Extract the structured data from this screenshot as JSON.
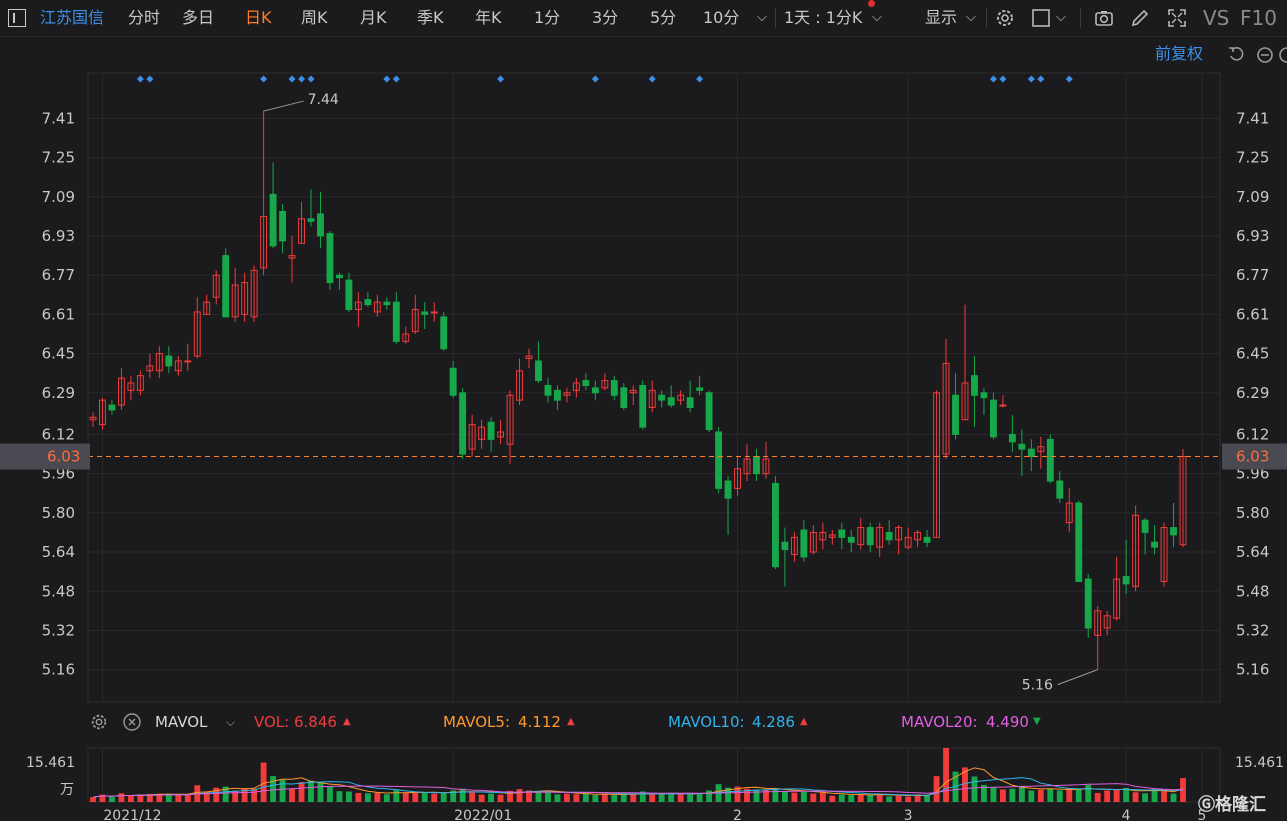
{
  "toolbar": {
    "stock_name": "江苏国信",
    "tabs": [
      "分时",
      "多日",
      "日K",
      "周K",
      "月K",
      "季K",
      "年K",
      "1分",
      "3分",
      "5分",
      "10分"
    ],
    "active_tab": "日K",
    "period_select": "1天 : 1分K",
    "display_label": "显示",
    "vs_label": "VS",
    "f10_label": "F10",
    "icons": [
      "settings-icon",
      "square-icon",
      "camera-icon",
      "pencil-icon",
      "fullscreen-icon"
    ]
  },
  "adjust_label": "前复权",
  "colors": {
    "up": "#f23b3b",
    "down": "#16a84a",
    "bg": "#1b1b1d",
    "grid": "#2a2a2c",
    "accent": "#ff7f27",
    "blue": "#3d8fe8"
  },
  "price_axis": {
    "ticks": [
      "7.41",
      "7.25",
      "7.09",
      "6.93",
      "6.77",
      "6.61",
      "6.45",
      "6.29",
      "6.12",
      "5.96",
      "5.80",
      "5.64",
      "5.48",
      "5.32",
      "5.16"
    ],
    "current": "6.03",
    "high_label": "7.44",
    "low_label": "5.16"
  },
  "mavol": {
    "title": "MAVOL",
    "vol_label": "VOL:",
    "vol_value": "6.846",
    "ma5_label": "MAVOL5:",
    "ma5_value": "4.112",
    "ma10_label": "MAVOL10:",
    "ma10_value": "4.286",
    "ma20_label": "MAVOL20:",
    "ma20_value": "4.490",
    "axis_value": "15.461",
    "axis_unit": "万"
  },
  "x_axis_labels": [
    "2021/12",
    "2022/01",
    "2",
    "3",
    "4",
    "5"
  ],
  "chart_data": {
    "type": "candlestick",
    "candles": [
      [
        6.18,
        6.19,
        6.21,
        6.15
      ],
      [
        6.16,
        6.26,
        6.27,
        6.14
      ],
      [
        6.24,
        6.22,
        6.26,
        6.2
      ],
      [
        6.24,
        6.35,
        6.39,
        6.22
      ],
      [
        6.3,
        6.33,
        6.36,
        6.26
      ],
      [
        6.3,
        6.36,
        6.38,
        6.28
      ],
      [
        6.38,
        6.4,
        6.45,
        6.35
      ],
      [
        6.38,
        6.45,
        6.48,
        6.35
      ],
      [
        6.44,
        6.4,
        6.48,
        6.37
      ],
      [
        6.38,
        6.42,
        6.44,
        6.36
      ],
      [
        6.42,
        6.42,
        6.49,
        6.38
      ],
      [
        6.44,
        6.62,
        6.68,
        6.43
      ],
      [
        6.61,
        6.66,
        6.69,
        6.61
      ],
      [
        6.68,
        6.77,
        6.79,
        6.65
      ],
      [
        6.85,
        6.6,
        6.88,
        6.6
      ],
      [
        6.6,
        6.73,
        6.8,
        6.58
      ],
      [
        6.61,
        6.74,
        6.78,
        6.58
      ],
      [
        6.6,
        6.79,
        6.81,
        6.58
      ],
      [
        6.8,
        7.01,
        7.44,
        6.77
      ],
      [
        7.1,
        6.89,
        7.23,
        6.88
      ],
      [
        7.03,
        6.91,
        7.06,
        6.86
      ],
      [
        6.84,
        6.85,
        6.93,
        6.74
      ],
      [
        6.9,
        7.0,
        7.07,
        6.9
      ],
      [
        7.0,
        6.99,
        7.12,
        6.97
      ],
      [
        7.02,
        6.93,
        7.11,
        6.88
      ],
      [
        6.94,
        6.74,
        6.95,
        6.71
      ],
      [
        6.77,
        6.76,
        6.78,
        6.71
      ],
      [
        6.75,
        6.63,
        6.78,
        6.62
      ],
      [
        6.63,
        6.66,
        6.7,
        6.56
      ],
      [
        6.67,
        6.65,
        6.7,
        6.64
      ],
      [
        6.62,
        6.66,
        6.69,
        6.6
      ],
      [
        6.66,
        6.65,
        6.68,
        6.63
      ],
      [
        6.66,
        6.5,
        6.7,
        6.49
      ],
      [
        6.5,
        6.53,
        6.56,
        6.49
      ],
      [
        6.54,
        6.63,
        6.69,
        6.53
      ],
      [
        6.62,
        6.61,
        6.66,
        6.55
      ],
      [
        6.62,
        6.62,
        6.66,
        6.58
      ],
      [
        6.6,
        6.47,
        6.62,
        6.46
      ],
      [
        6.39,
        6.28,
        6.42,
        6.27
      ],
      [
        6.29,
        6.04,
        6.31,
        6.02
      ],
      [
        6.06,
        6.16,
        6.2,
        6.03
      ],
      [
        6.1,
        6.15,
        6.18,
        6.06
      ],
      [
        6.17,
        6.1,
        6.19,
        6.05
      ],
      [
        6.11,
        6.13,
        6.18,
        6.08
      ],
      [
        6.08,
        6.28,
        6.3,
        6.0
      ],
      [
        6.26,
        6.38,
        6.43,
        6.24
      ],
      [
        6.43,
        6.44,
        6.47,
        6.39
      ],
      [
        6.42,
        6.34,
        6.5,
        6.33
      ],
      [
        6.32,
        6.28,
        6.35,
        6.25
      ],
      [
        6.3,
        6.26,
        6.32,
        6.22
      ],
      [
        6.28,
        6.29,
        6.31,
        6.25
      ],
      [
        6.3,
        6.33,
        6.35,
        6.27
      ],
      [
        6.34,
        6.32,
        6.37,
        6.3
      ],
      [
        6.31,
        6.29,
        6.34,
        6.26
      ],
      [
        6.31,
        6.34,
        6.37,
        6.3
      ],
      [
        6.34,
        6.28,
        6.36,
        6.26
      ],
      [
        6.31,
        6.23,
        6.33,
        6.22
      ],
      [
        6.29,
        6.3,
        6.32,
        6.24
      ],
      [
        6.32,
        6.15,
        6.34,
        6.14
      ],
      [
        6.23,
        6.3,
        6.34,
        6.21
      ],
      [
        6.28,
        6.26,
        6.3,
        6.23
      ],
      [
        6.27,
        6.24,
        6.32,
        6.23
      ],
      [
        6.26,
        6.28,
        6.3,
        6.24
      ],
      [
        6.27,
        6.23,
        6.34,
        6.21
      ],
      [
        6.31,
        6.3,
        6.36,
        6.28
      ],
      [
        6.29,
        6.14,
        6.3,
        6.13
      ],
      [
        6.13,
        5.9,
        6.15,
        5.88
      ],
      [
        5.93,
        5.86,
        5.95,
        5.71
      ],
      [
        5.9,
        5.98,
        6.03,
        5.87
      ],
      [
        5.96,
        6.02,
        6.08,
        5.93
      ],
      [
        6.03,
        5.96,
        6.06,
        5.93
      ],
      [
        5.96,
        6.02,
        6.09,
        5.94
      ],
      [
        5.92,
        5.58,
        5.95,
        5.57
      ],
      [
        5.68,
        5.65,
        5.74,
        5.5
      ],
      [
        5.63,
        5.7,
        5.72,
        5.6
      ],
      [
        5.73,
        5.62,
        5.77,
        5.6
      ],
      [
        5.64,
        5.72,
        5.75,
        5.63
      ],
      [
        5.69,
        5.72,
        5.76,
        5.65
      ],
      [
        5.7,
        5.71,
        5.73,
        5.67
      ],
      [
        5.73,
        5.7,
        5.76,
        5.65
      ],
      [
        5.7,
        5.68,
        5.73,
        5.64
      ],
      [
        5.67,
        5.74,
        5.78,
        5.65
      ],
      [
        5.74,
        5.67,
        5.76,
        5.64
      ],
      [
        5.66,
        5.74,
        5.76,
        5.62
      ],
      [
        5.72,
        5.69,
        5.77,
        5.67
      ],
      [
        5.69,
        5.74,
        5.75,
        5.63
      ],
      [
        5.66,
        5.7,
        5.74,
        5.65
      ],
      [
        5.69,
        5.72,
        5.73,
        5.66
      ],
      [
        5.7,
        5.68,
        5.73,
        5.66
      ],
      [
        5.7,
        6.29,
        6.3,
        5.7
      ],
      [
        6.04,
        6.41,
        6.51,
        6.02
      ],
      [
        6.28,
        6.12,
        6.37,
        6.1
      ],
      [
        6.18,
        6.33,
        6.65,
        6.18
      ],
      [
        6.36,
        6.28,
        6.44,
        6.15
      ],
      [
        6.29,
        6.27,
        6.31,
        6.2
      ],
      [
        6.26,
        6.11,
        6.29,
        6.1
      ],
      [
        6.24,
        6.24,
        6.28,
        6.23
      ],
      [
        6.12,
        6.09,
        6.2,
        6.05
      ],
      [
        6.08,
        6.06,
        6.14,
        5.95
      ],
      [
        6.06,
        6.03,
        6.1,
        5.97
      ],
      [
        6.05,
        6.07,
        6.11,
        5.98
      ],
      [
        6.1,
        5.93,
        6.12,
        5.92
      ],
      [
        5.93,
        5.86,
        5.97,
        5.84
      ],
      [
        5.76,
        5.84,
        5.9,
        5.72
      ],
      [
        5.84,
        5.52,
        5.85,
        5.52
      ],
      [
        5.53,
        5.33,
        5.55,
        5.29
      ],
      [
        5.3,
        5.4,
        5.42,
        5.16
      ],
      [
        5.33,
        5.38,
        5.4,
        5.3
      ],
      [
        5.37,
        5.53,
        5.62,
        5.36
      ],
      [
        5.54,
        5.51,
        5.69,
        5.47
      ],
      [
        5.5,
        5.79,
        5.83,
        5.48
      ],
      [
        5.77,
        5.72,
        5.78,
        5.63
      ],
      [
        5.68,
        5.66,
        5.75,
        5.63
      ],
      [
        5.52,
        5.74,
        5.76,
        5.5
      ],
      [
        5.74,
        5.71,
        5.84,
        5.66
      ],
      [
        5.67,
        6.03,
        6.06,
        5.66
      ]
    ],
    "volume": [
      1.4,
      2.1,
      1.4,
      2.5,
      1.9,
      2.1,
      2.3,
      2.3,
      2.4,
      2.1,
      2.1,
      4.8,
      3.0,
      4.1,
      4.4,
      3.3,
      4.0,
      3.8,
      11.3,
      7.4,
      6.3,
      3.9,
      5.7,
      6.1,
      5.6,
      4.3,
      3.1,
      3.0,
      2.6,
      2.5,
      2.6,
      2.2,
      3.4,
      2.6,
      2.9,
      2.7,
      2.4,
      2.6,
      3.3,
      3.8,
      2.7,
      2.1,
      2.4,
      2.1,
      3.2,
      3.7,
      3.3,
      3.1,
      2.9,
      2.2,
      2.4,
      2.2,
      2.4,
      2.0,
      2.3,
      2.0,
      2.4,
      2.1,
      3.0,
      2.3,
      2.4,
      2.3,
      2.3,
      2.6,
      2.2,
      3.3,
      5.1,
      4.1,
      4.4,
      3.8,
      3.6,
      3.6,
      3.9,
      3.1,
      2.7,
      2.9,
      2.4,
      2.6,
      1.8,
      2.1,
      2.0,
      2.2,
      1.9,
      2.4,
      1.6,
      1.8,
      1.5,
      2.2,
      1.9,
      7.4,
      15.461,
      8.7,
      9.9,
      7.3,
      4.9,
      4.3,
      3.6,
      3.8,
      4.6,
      3.3,
      3.5,
      3.7,
      3.3,
      3.9,
      3.5,
      4.9,
      2.6,
      3.3,
      3.5,
      4.0,
      2.8,
      2.5,
      3.7,
      3.3,
      2.4,
      6.846
    ],
    "markers": [
      5,
      6,
      18,
      21,
      22,
      23,
      31,
      32,
      43,
      53,
      59,
      64,
      95,
      96,
      99,
      100,
      103
    ]
  }
}
